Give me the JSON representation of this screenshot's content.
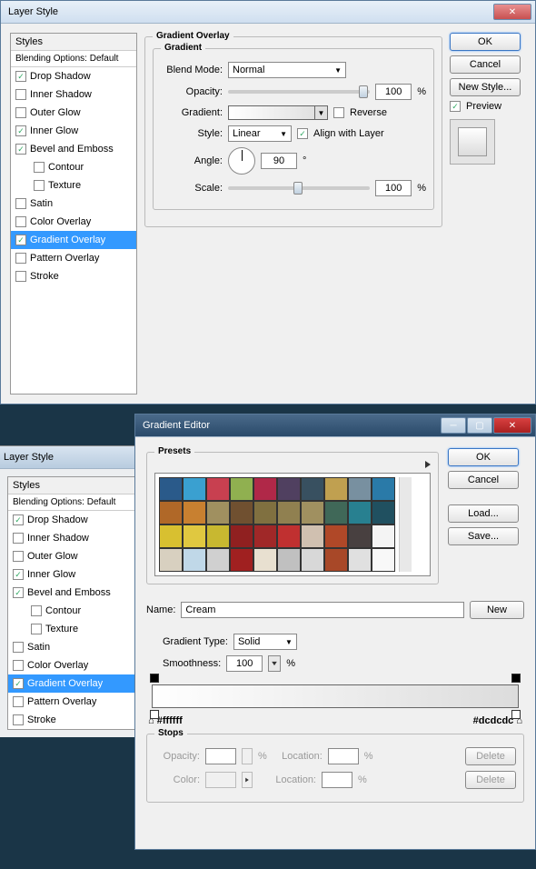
{
  "layerStyle": {
    "title": "Layer Style",
    "stylesHeader": "Styles",
    "blendingDefault": "Blending Options: Default",
    "items": [
      {
        "label": "Drop Shadow",
        "checked": true
      },
      {
        "label": "Inner Shadow",
        "checked": false
      },
      {
        "label": "Outer Glow",
        "checked": false
      },
      {
        "label": "Inner Glow",
        "checked": true
      },
      {
        "label": "Bevel and Emboss",
        "checked": true
      },
      {
        "label": "Contour",
        "checked": false,
        "indent": true
      },
      {
        "label": "Texture",
        "checked": false,
        "indent": true
      },
      {
        "label": "Satin",
        "checked": false
      },
      {
        "label": "Color Overlay",
        "checked": false
      },
      {
        "label": "Gradient Overlay",
        "checked": true,
        "selected": true
      },
      {
        "label": "Pattern Overlay",
        "checked": false
      },
      {
        "label": "Stroke",
        "checked": false
      }
    ],
    "panel": {
      "title": "Gradient Overlay",
      "gradientTitle": "Gradient",
      "blendModeLabel": "Blend Mode:",
      "blendMode": "Normal",
      "opacityLabel": "Opacity:",
      "opacity": "100",
      "opacityUnit": "%",
      "gradientLabel": "Gradient:",
      "reverseLabel": "Reverse",
      "reverse": false,
      "styleLabel": "Style:",
      "style": "Linear",
      "alignLabel": "Align with Layer",
      "align": true,
      "angleLabel": "Angle:",
      "angle": "90",
      "angleUnit": "°",
      "scaleLabel": "Scale:",
      "scale": "100",
      "scaleUnit": "%"
    },
    "buttons": {
      "ok": "OK",
      "cancel": "Cancel",
      "newStyle": "New Style...",
      "previewLabel": "Preview",
      "preview": true
    }
  },
  "gradEditor": {
    "title": "Gradient Editor",
    "presetsLabel": "Presets",
    "swatches": [
      "#2a5a8a",
      "#3aa0d0",
      "#c84050",
      "#90b050",
      "#b02848",
      "#504060",
      "#385060",
      "#c0a050",
      "#7890a0",
      "#2a7aa8",
      "#b06828",
      "#c88030",
      "#a09060",
      "#705030",
      "#807040",
      "#908050",
      "#a09060",
      "#406858",
      "#288090",
      "#205060",
      "#d8c030",
      "#e0c840",
      "#c8b830",
      "#902020",
      "#a02828",
      "#c03030",
      "#d0c0b0",
      "#b04828",
      "#484040",
      "#f4f4f4"
    ],
    "nameLabel": "Name:",
    "name": "Cream",
    "newBtn": "New",
    "gradTypeLabel": "Gradient Type:",
    "gradType": "Solid",
    "smoothLabel": "Smoothness:",
    "smooth": "100",
    "smoothUnit": "%",
    "hexLeft": "#ffffff",
    "hexRight": "#dcdcdc",
    "stopsTitle": "Stops",
    "stops": {
      "opacityLabel": "Opacity:",
      "opacityUnit": "%",
      "locationLabel": "Location:",
      "locationUnit": "%",
      "colorLabel": "Color:",
      "deleteLabel": "Delete"
    },
    "buttons": {
      "ok": "OK",
      "cancel": "Cancel",
      "load": "Load...",
      "save": "Save..."
    }
  }
}
